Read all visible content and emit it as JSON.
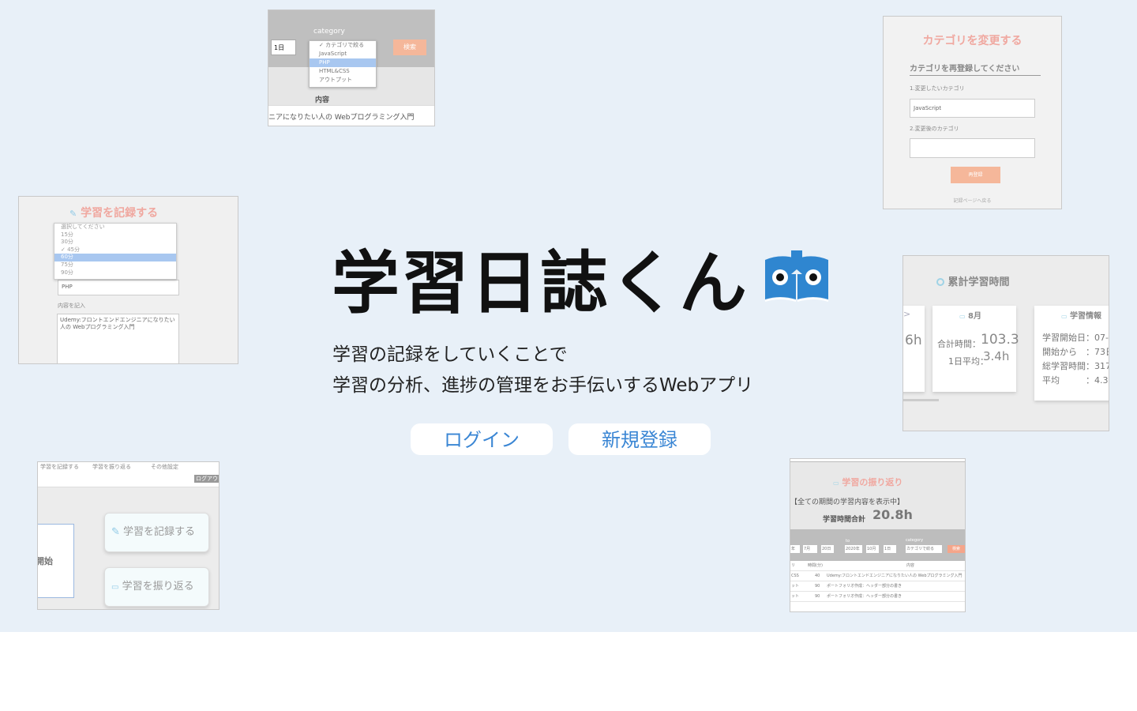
{
  "app": {
    "title": "学習日誌くん",
    "tagline_line1": "学習の記録をしていくことで",
    "tagline_line2": "学習の分析、進捗の管理をお手伝いするWebアプリ",
    "login_label": "ログイン",
    "signup_label": "新規登録",
    "logo_icon": "book-icon",
    "colors": {
      "hero_bg": "#e8f0f8",
      "accent": "#3a86d4",
      "logo_blue": "#2f86d0"
    }
  },
  "shot_category": {
    "label": "category",
    "day_select": "1日",
    "search_button": "検索",
    "options": [
      "✓ カテゴリで絞る",
      "JavaScript",
      "PHP",
      "HTML&CSS",
      "アウトプット"
    ],
    "content_header": "内容",
    "row_text": "ニアになりたい人の Webプログラミング入門"
  },
  "shot_change": {
    "heading": "カテゴリを変更する",
    "subheading": "カテゴリを再登録してください",
    "label1": "1.変更したいカテゴリ",
    "select_value": "JavaScript",
    "label2": "2.変更後のカテゴリ",
    "submit": "再登録",
    "back_link": "記録ページへ戻る"
  },
  "shot_record": {
    "heading": "学習を記録する",
    "options": [
      "選択してください",
      "15分",
      "30分",
      "✓ 45分",
      "60分",
      "75分",
      "90分"
    ],
    "category_value": "PHP",
    "content_label": "内容を記入",
    "content_text": "Udemy:フロントエンドエンジニアになりたい人の Webプログラミング入門"
  },
  "shot_total": {
    "heading": "累計学習時間",
    "partial_big": "6h",
    "month_title": "8月",
    "total_label": "合計時間：",
    "total_value": "103.3",
    "avg_label": "1日平均：",
    "avg_value": "3.4h",
    "info_title": "学習情報",
    "info_lines": [
      "学習開始日：07-",
      "開始から　：73日",
      "総学習時間：317",
      "平均　　　：4.3"
    ]
  },
  "shot_dash": {
    "nav_items": [
      "学習を記録する",
      "学習を振り返る",
      "その他設定"
    ],
    "logout": "ログアウ",
    "left_box_text": "開始",
    "record_button": "学習を記録する",
    "review_button": "学習を振り返る"
  },
  "shot_review": {
    "heading": "学習の振り返り",
    "period": "【全ての期間の学習内容を表示中】",
    "total_label": "学習時間合計",
    "total_value": "20.8h",
    "to_label": "to",
    "category_label": "category",
    "category_placeholder": "カテゴリで絞る",
    "search": "検索",
    "filter_fields": [
      "年",
      "7月",
      "20日",
      "2020年",
      "10月",
      "1日"
    ],
    "col_category": "リ",
    "col_time": "時間(分)",
    "col_content": "内容",
    "rows": [
      {
        "category": "CSS",
        "time": "40",
        "content": "Udemy:フロントエンドエンジニアになりたい人の Webプログラミング入門"
      },
      {
        "category": "ット",
        "time": "90",
        "content": "ポートフォリオ作成：ヘッダー部分の書き"
      },
      {
        "category": "ット",
        "time": "90",
        "content": "ポートフォリオ作成：ヘッダー部分の書き"
      }
    ]
  }
}
